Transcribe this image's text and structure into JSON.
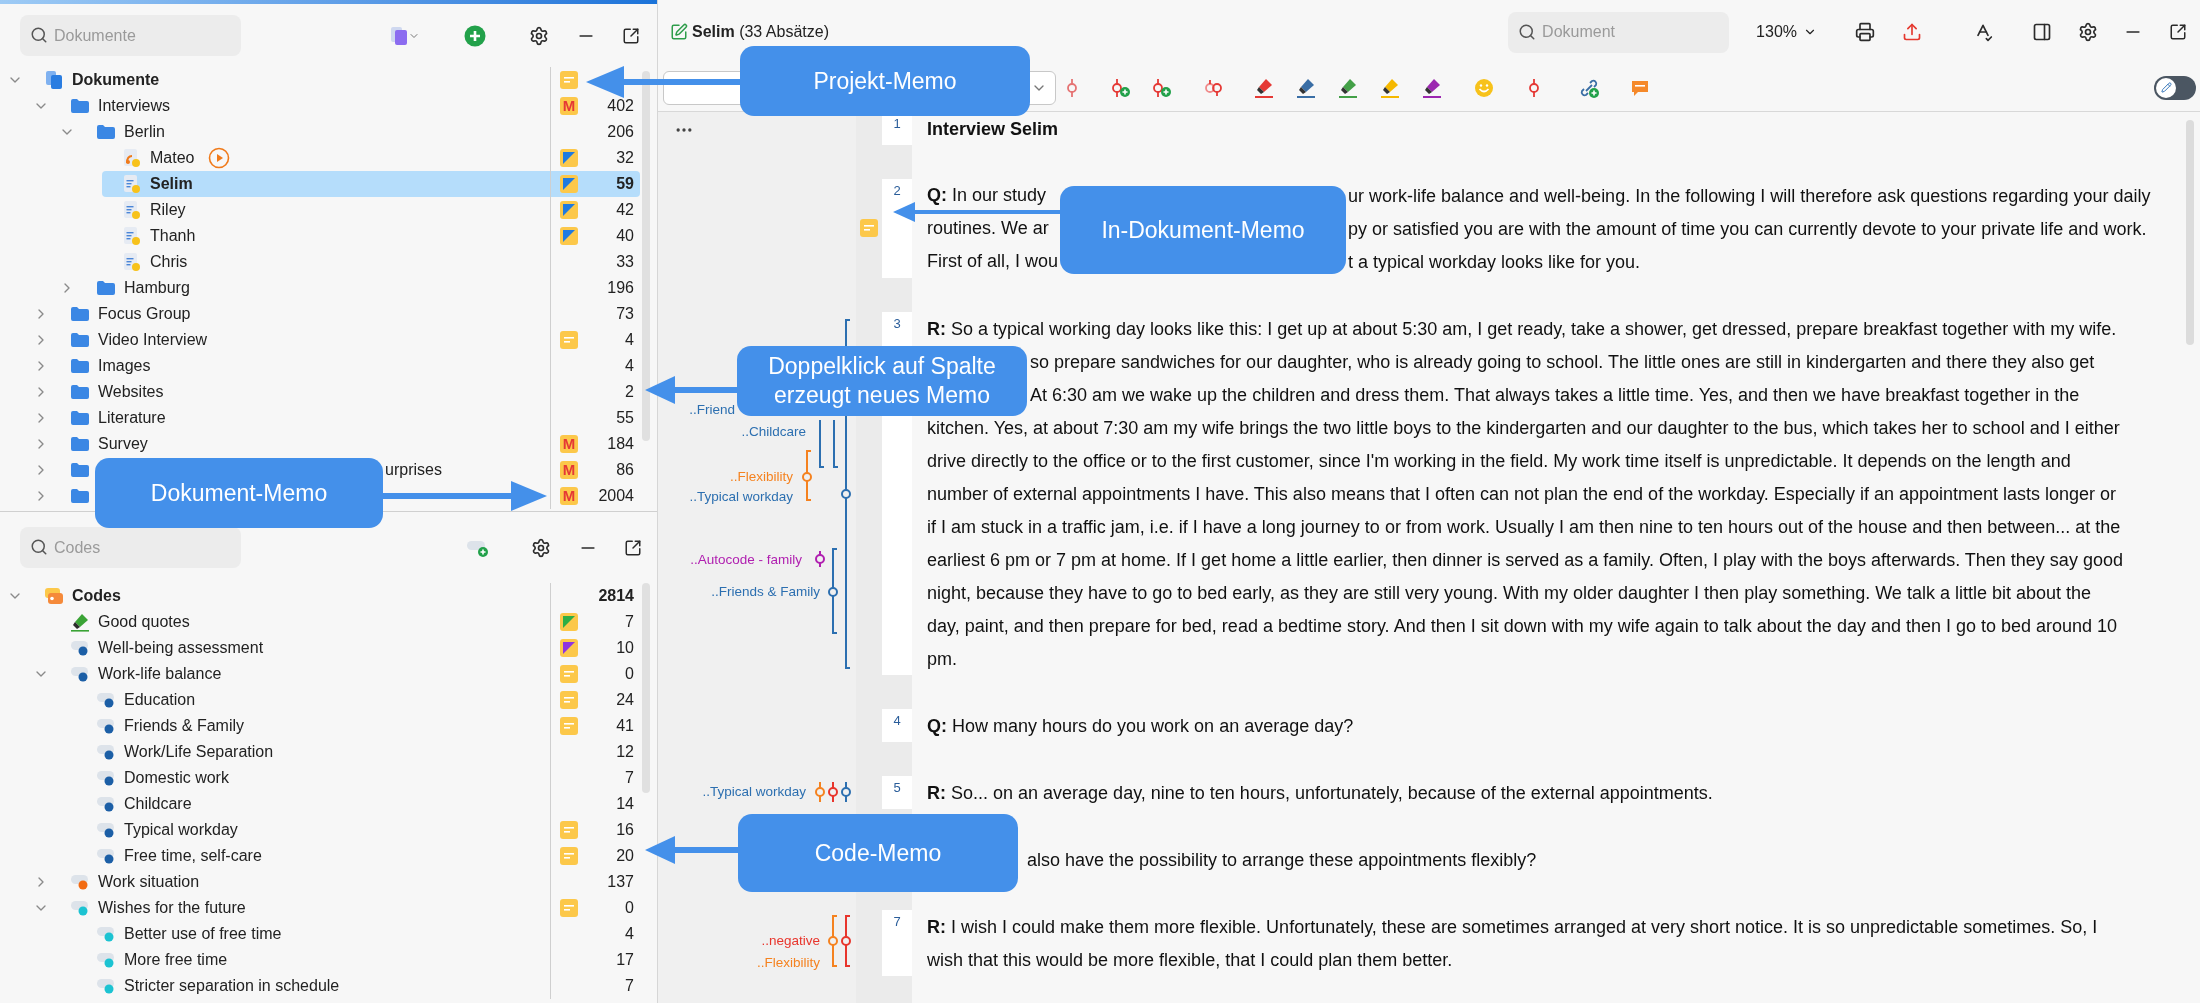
{
  "documents": {
    "search": {
      "placeholder": "Dokumente"
    },
    "items": [
      {
        "name": "Dokumente",
        "kind": "root",
        "expanded": true,
        "selected": false,
        "memo": {
          "kind": "note"
        },
        "children": [
          {
            "name": "Interviews",
            "kind": "folder",
            "expanded": true,
            "selected": false,
            "memo": {
              "kind": "letter",
              "letter": "M"
            },
            "count": "402",
            "children": [
              {
                "name": "Berlin",
                "kind": "folder",
                "expanded": true,
                "selected": false,
                "count": "206",
                "children": [
                  {
                    "name": "Mateo",
                    "kind": "audio",
                    "selected": false,
                    "memo": {
                      "kind": "corner",
                      "color": "#1f7ae0"
                    },
                    "count": "32"
                  },
                  {
                    "name": "Selim",
                    "kind": "text",
                    "selected": true,
                    "memo": {
                      "kind": "corner",
                      "color": "#1f7ae0"
                    },
                    "count": "59"
                  },
                  {
                    "name": "Riley",
                    "kind": "text",
                    "selected": false,
                    "memo": {
                      "kind": "corner",
                      "color": "#1f7ae0"
                    },
                    "count": "42"
                  },
                  {
                    "name": "Thanh",
                    "kind": "text",
                    "selected": false,
                    "memo": {
                      "kind": "corner",
                      "color": "#1f7ae0"
                    },
                    "count": "40"
                  },
                  {
                    "name": "Chris",
                    "kind": "text",
                    "selected": false,
                    "count": "33"
                  }
                ]
              },
              {
                "name": "Hamburg",
                "kind": "folder",
                "expanded": false,
                "selected": false,
                "count": "196"
              }
            ]
          },
          {
            "name": "Focus Group",
            "kind": "folder",
            "expanded": false,
            "selected": false,
            "count": "73"
          },
          {
            "name": "Video Interview",
            "kind": "folder",
            "expanded": false,
            "selected": false,
            "memo": {
              "kind": "note"
            },
            "count": "4"
          },
          {
            "name": "Images",
            "kind": "folder",
            "expanded": false,
            "selected": false,
            "count": "4"
          },
          {
            "name": "Websites",
            "kind": "folder",
            "expanded": false,
            "selected": false,
            "count": "2"
          },
          {
            "name": "Literature",
            "kind": "folder",
            "expanded": false,
            "selected": false,
            "count": "55"
          },
          {
            "name": "Survey",
            "kind": "folder",
            "expanded": false,
            "selected": false,
            "memo": {
              "kind": "letter",
              "letter": "M"
            },
            "count": "184"
          },
          {
            "name": "urprises",
            "kind": "folder",
            "expanded": false,
            "selected": false,
            "memo": {
              "kind": "letter",
              "letter": "M"
            },
            "count": "86"
          },
          {
            "kind": "folder",
            "expanded": false,
            "selected": false,
            "memo": {
              "kind": "letter",
              "letter": "M"
            },
            "count": "2004"
          }
        ]
      }
    ]
  },
  "codes": {
    "search": {
      "placeholder": "Codes"
    },
    "items": [
      {
        "name": "Codes",
        "kind": "root",
        "expanded": true,
        "selected": false,
        "count": "2814",
        "children": [
          {
            "name": "Good quotes",
            "kind": "highlighter",
            "selected": false,
            "memo": {
              "kind": "corner",
              "color": "#2fae45"
            },
            "count": "7"
          },
          {
            "name": "Well-being assessment",
            "kind": "code",
            "color": "#1c5fa6",
            "selected": false,
            "memo": {
              "kind": "corner",
              "color": "#8e35e0"
            },
            "count": "10"
          },
          {
            "name": "Work-life balance",
            "kind": "code",
            "color": "#1c5fa6",
            "expanded": true,
            "selected": false,
            "memo": {
              "kind": "note"
            },
            "count": "0",
            "children": [
              {
                "name": "Education",
                "kind": "code",
                "color": "#1c5fa6",
                "selected": false,
                "memo": {
                  "kind": "note"
                },
                "count": "24"
              },
              {
                "name": "Friends & Family",
                "kind": "code",
                "color": "#1c5fa6",
                "selected": false,
                "memo": {
                  "kind": "note"
                },
                "count": "41"
              },
              {
                "name": "Work/Life Separation",
                "kind": "code",
                "color": "#1c5fa6",
                "selected": false,
                "count": "12"
              },
              {
                "name": "Domestic work",
                "kind": "code",
                "color": "#1c5fa6",
                "selected": false,
                "count": "7"
              },
              {
                "name": "Childcare",
                "kind": "code",
                "color": "#1c5fa6",
                "selected": false,
                "count": "14"
              },
              {
                "name": "Typical workday",
                "kind": "code",
                "color": "#1c5fa6",
                "selected": false,
                "memo": {
                  "kind": "note"
                },
                "count": "16"
              },
              {
                "name": "Free time, self-care",
                "kind": "code",
                "color": "#1c5fa6",
                "selected": false,
                "memo": {
                  "kind": "note"
                },
                "count": "20"
              }
            ]
          },
          {
            "name": "Work situation",
            "kind": "code",
            "color": "#f26b12",
            "expanded": false,
            "selected": false,
            "count": "137"
          },
          {
            "name": "Wishes for the future",
            "kind": "code",
            "color": "#1cc3d2",
            "expanded": true,
            "selected": false,
            "memo": {
              "kind": "note"
            },
            "count": "0",
            "children": [
              {
                "name": "Better use of free time",
                "kind": "code",
                "color": "#1cc3d2",
                "selected": false,
                "count": "4"
              },
              {
                "name": "More free time",
                "kind": "code",
                "color": "#1cc3d2",
                "selected": false,
                "count": "17"
              },
              {
                "name": "Stricter separation in schedule",
                "kind": "code",
                "color": "#1cc3d2",
                "selected": false,
                "count": "7"
              }
            ]
          }
        ]
      }
    ]
  },
  "document": {
    "title": "**Selim** (33 Absätze)",
    "edit_toggle": {
      "on": false
    },
    "search": {
      "placeholder": "Dokument"
    },
    "zoom": "130%",
    "highlighters": [
      {
        "color": "#e53935"
      },
      {
        "color": "#3a6ea5"
      },
      {
        "color": "#43a047"
      },
      {
        "color": "#f5b800"
      },
      {
        "color": "#9c27b0"
      }
    ],
    "margin_codes": [
      {
        "label": "..Friend",
        "color": "#2c6fb0"
      },
      {
        "label": "..Childcare",
        "color": "#2c6fb0"
      },
      {
        "label": "..Flexibility",
        "color": "#f5821f"
      },
      {
        "label": "..Typical workday",
        "color": "#2c6fb0"
      },
      {
        "label": "..Autocode - family",
        "color": "#b01fb0"
      },
      {
        "label": "..Friends & Family",
        "color": "#2c6fb0"
      },
      {
        "label": "..Typical workday",
        "color": "#2c6fb0"
      },
      {
        "label": "..negative",
        "color": "#e8352c"
      },
      {
        "label": "..Flexibility",
        "color": "#f5821f"
      }
    ],
    "paragraphs": [
      {
        "number": "1",
        "kind": "heading",
        "lines": [
          [
            "Interview Selim"
          ]
        ]
      },
      {
        "number": "2",
        "kind": "speech",
        "memo": true,
        "lines": [
          [
            "**Q:** In our study",
            "ur work-life balance and well-being. In the following I will therefore ask questions regarding your daily"
          ],
          [
            "routines. We ar",
            "py or satisfied you are with the amount of time you can currently devote to your private life and work."
          ],
          [
            "First of all, I wou",
            "t a typical workday looks like for you."
          ]
        ]
      },
      {
        "number": "3",
        "kind": "speech",
        "lines": [
          [
            "**R:** So a typical working day looks like this: I get up at about 5:30 am, I get ready, take a shower, get dressed, prepare breakfast together with my wife."
          ],
          [
            "so prepare sandwiches for our daughter, who is already going to school. The little ones are still in kindergarten and there they also get"
          ],
          [
            "At 6:30 am we wake up the children and dress them. That always takes a little time. Yes, and then we have breakfast together in the"
          ],
          [
            "kitchen. Yes, at about 7:30 am my wife brings the two little boys to the kindergarten and our daughter to the bus, which takes her to school and I either"
          ],
          [
            "drive directly to the office or to the first customer, since I'm working in the field. My work time itself is unpredictable. It depends on the length and"
          ],
          [
            "number of external appointments I have. This also means that I often can not plan the end of the workday. Especially if an appointment lasts longer or"
          ],
          [
            "if I am stuck in a traffic jam, i.e. if I have a long journey to or from work. Usually I am then nine to ten hours out of the house and then between... at the"
          ],
          [
            "earliest 6 pm or 7 pm at home. If I get home a little earlier, then dinner is served as a family. Often, I play with the boys afterwards. Then they say good"
          ],
          [
            "night, because they have to go to bed early, as they are still very young. With my older daughter I then play something. We talk a little bit about the"
          ],
          [
            "day, paint, and then prepare for bed, read a bedtime story. And then I sit down with my wife again to talk about the day and then I go to bed around 10"
          ],
          [
            "pm."
          ]
        ]
      },
      {
        "number": "4",
        "kind": "speech",
        "lines": [
          [
            "**Q:** How many hours do you work on an average day?"
          ]
        ]
      },
      {
        "number": "5",
        "kind": "speech",
        "lines": [
          [
            "**R:** So... on an average day, nine to ten hours, unfortunately, because of the external appointments."
          ]
        ]
      },
      {
        "kind": "speech",
        "lines": [
          [
            "also have the possibility to arrange these appointments flexibly?"
          ]
        ]
      },
      {
        "number": "7",
        "kind": "speech",
        "lines": [
          [
            "**R:** I wish I could make them more flexible. Unfortunately, these are sometimes arranged at very short notice. It is so unpredictable sometimes. So, I"
          ],
          [
            "wish that this would be more flexible, that I could plan them better."
          ]
        ]
      }
    ]
  },
  "callouts": [
    {
      "text": "Projekt-Memo"
    },
    {
      "text": "In-Dokument-Memo"
    },
    {
      "text": "Doppelklick auf Spalte erzeugt neues Memo"
    },
    {
      "text": "Dokument-Memo"
    },
    {
      "text": "Code-Memo"
    }
  ]
}
